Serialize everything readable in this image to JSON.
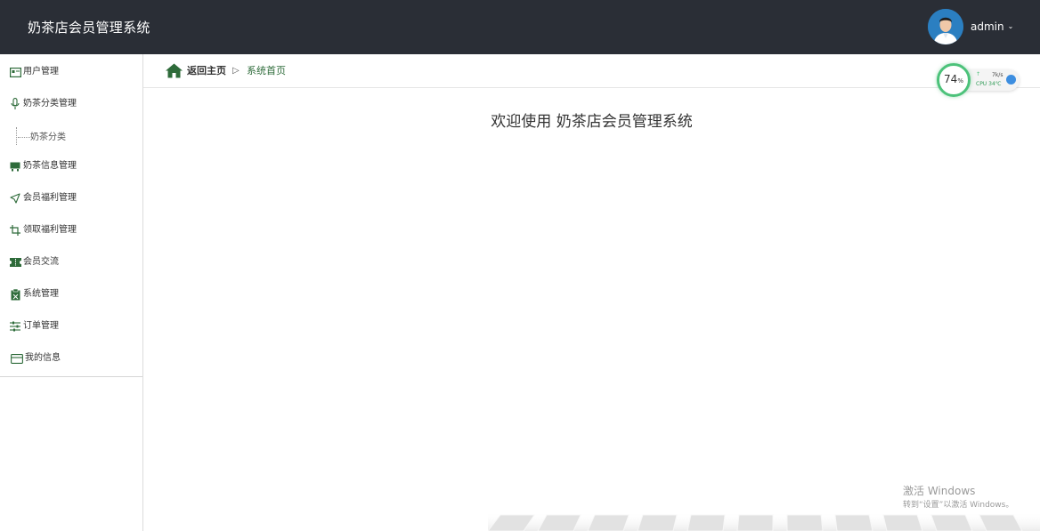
{
  "header": {
    "title": "奶茶店会员管理系统",
    "username": "admin",
    "caret": "⌄"
  },
  "sidebar": {
    "items": [
      {
        "label": "用户管理",
        "icon": "id-card-icon"
      },
      {
        "label": "奶茶分类管理",
        "icon": "microphone-icon"
      },
      {
        "label": "奶茶信息管理",
        "icon": "inbox-icon"
      },
      {
        "label": "会员福利管理",
        "icon": "send-icon"
      },
      {
        "label": "领取福利管理",
        "icon": "crop-icon"
      },
      {
        "label": "会员交流",
        "icon": "ticket-icon"
      },
      {
        "label": "系统管理",
        "icon": "clipboard-icon"
      },
      {
        "label": "订单管理",
        "icon": "sliders-icon"
      },
      {
        "label": "我的信息",
        "icon": "credit-card-icon"
      }
    ],
    "sub_items": [
      {
        "label": "奶茶分类"
      }
    ]
  },
  "breadcrumb": {
    "home": "返回主页",
    "separator": "▷",
    "current": "系统首页"
  },
  "main": {
    "welcome": "欢迎使用 奶茶店会员管理系统"
  },
  "cpu_widget": {
    "percent": "74",
    "percent_unit": "%",
    "speed": "7k/s",
    "up_arrow": "↑",
    "label": "CPU",
    "temp": "34℃"
  },
  "watermark": {
    "line1": "激活 Windows",
    "line2": "转到“设置”以激活 Windows。"
  },
  "colors": {
    "header_bg": "#2a2e36",
    "accent_green": "#2e6b3a",
    "cpu_ring": "#4cc27a"
  }
}
